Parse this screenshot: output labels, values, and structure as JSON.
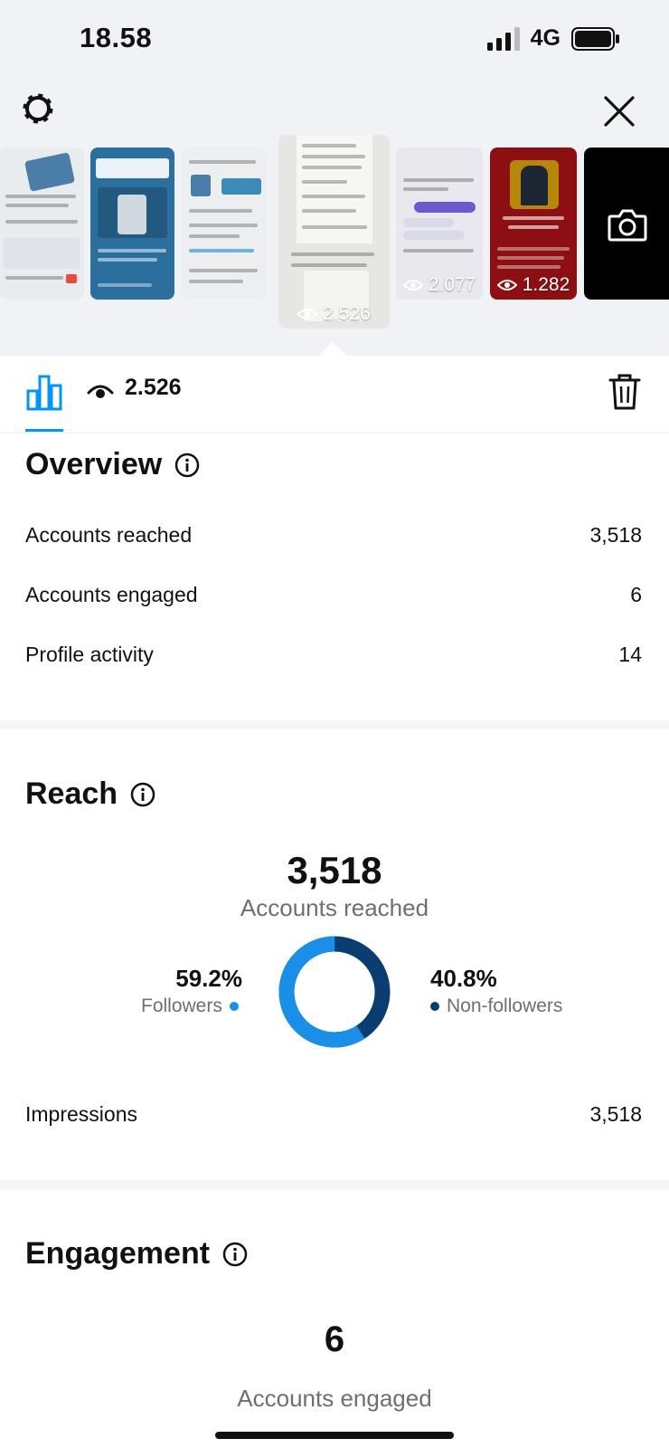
{
  "status": {
    "time": "18.58",
    "network": "4G"
  },
  "thumbnails": [
    {
      "views": ""
    },
    {
      "views": ""
    },
    {
      "views": ""
    },
    {
      "views": "2.526",
      "selected": true
    },
    {
      "views": "2.077"
    },
    {
      "views": "1.282"
    }
  ],
  "tabbar": {
    "views": "2.526"
  },
  "overview": {
    "title": "Overview",
    "rows": [
      {
        "label": "Accounts reached",
        "value": "3,518"
      },
      {
        "label": "Accounts engaged",
        "value": "6"
      },
      {
        "label": "Profile activity",
        "value": "14"
      }
    ]
  },
  "reach": {
    "title": "Reach",
    "total": "3,518",
    "total_label": "Accounts reached",
    "followers_pct": "59.2%",
    "followers_label": "Followers",
    "nonfollowers_pct": "40.8%",
    "nonfollowers_label": "Non-followers",
    "followers_fraction": 0.592,
    "impressions_label": "Impressions",
    "impressions_value": "3,518"
  },
  "engagement": {
    "title": "Engagement",
    "total": "6",
    "total_label": "Accounts engaged"
  },
  "colors": {
    "accent": "#0095f6",
    "followers": "#1a8fe8",
    "nonfollowers": "#0b3d73"
  }
}
